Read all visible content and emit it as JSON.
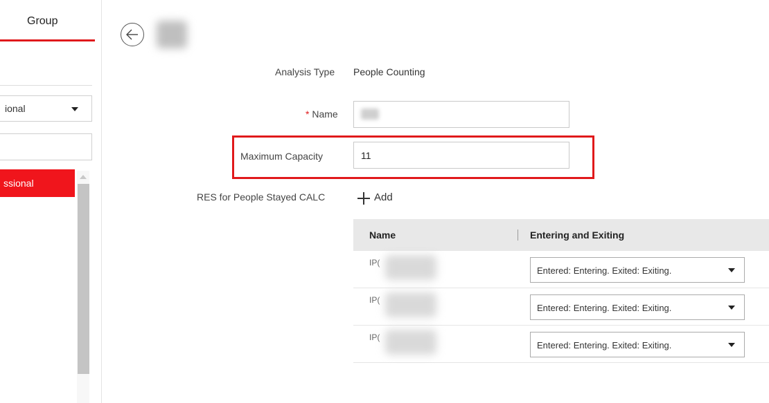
{
  "left_panel": {
    "tab_label": "Group",
    "scope_select_value": "ional",
    "selected_item_label": "ssional"
  },
  "form": {
    "analysis_type_label": "Analysis Type",
    "analysis_type_value": "People Counting",
    "name_required_mark": "*",
    "name_label": "Name",
    "max_capacity_label": "Maximum Capacity",
    "max_capacity_value": "11",
    "res_label": "RES for People Stayed CALC",
    "add_label": "Add"
  },
  "table": {
    "columns": [
      "Name",
      "Entering and Exiting"
    ],
    "rows": [
      {
        "name_prefix": "IP(",
        "direction": "Entered: Entering. Exited: Exiting."
      },
      {
        "name_prefix": "IP(",
        "direction": "Entered: Entering. Exited: Exiting."
      },
      {
        "name_prefix": "IP(",
        "direction": "Entered: Entering. Exited: Exiting."
      }
    ]
  },
  "colors": {
    "accent_red": "#e0191b",
    "table_header_bg": "#e8e8e8"
  },
  "icons": [
    "back-arrow-icon",
    "chevron-down-icon",
    "plus-icon",
    "scroll-up-arrow-icon"
  ]
}
